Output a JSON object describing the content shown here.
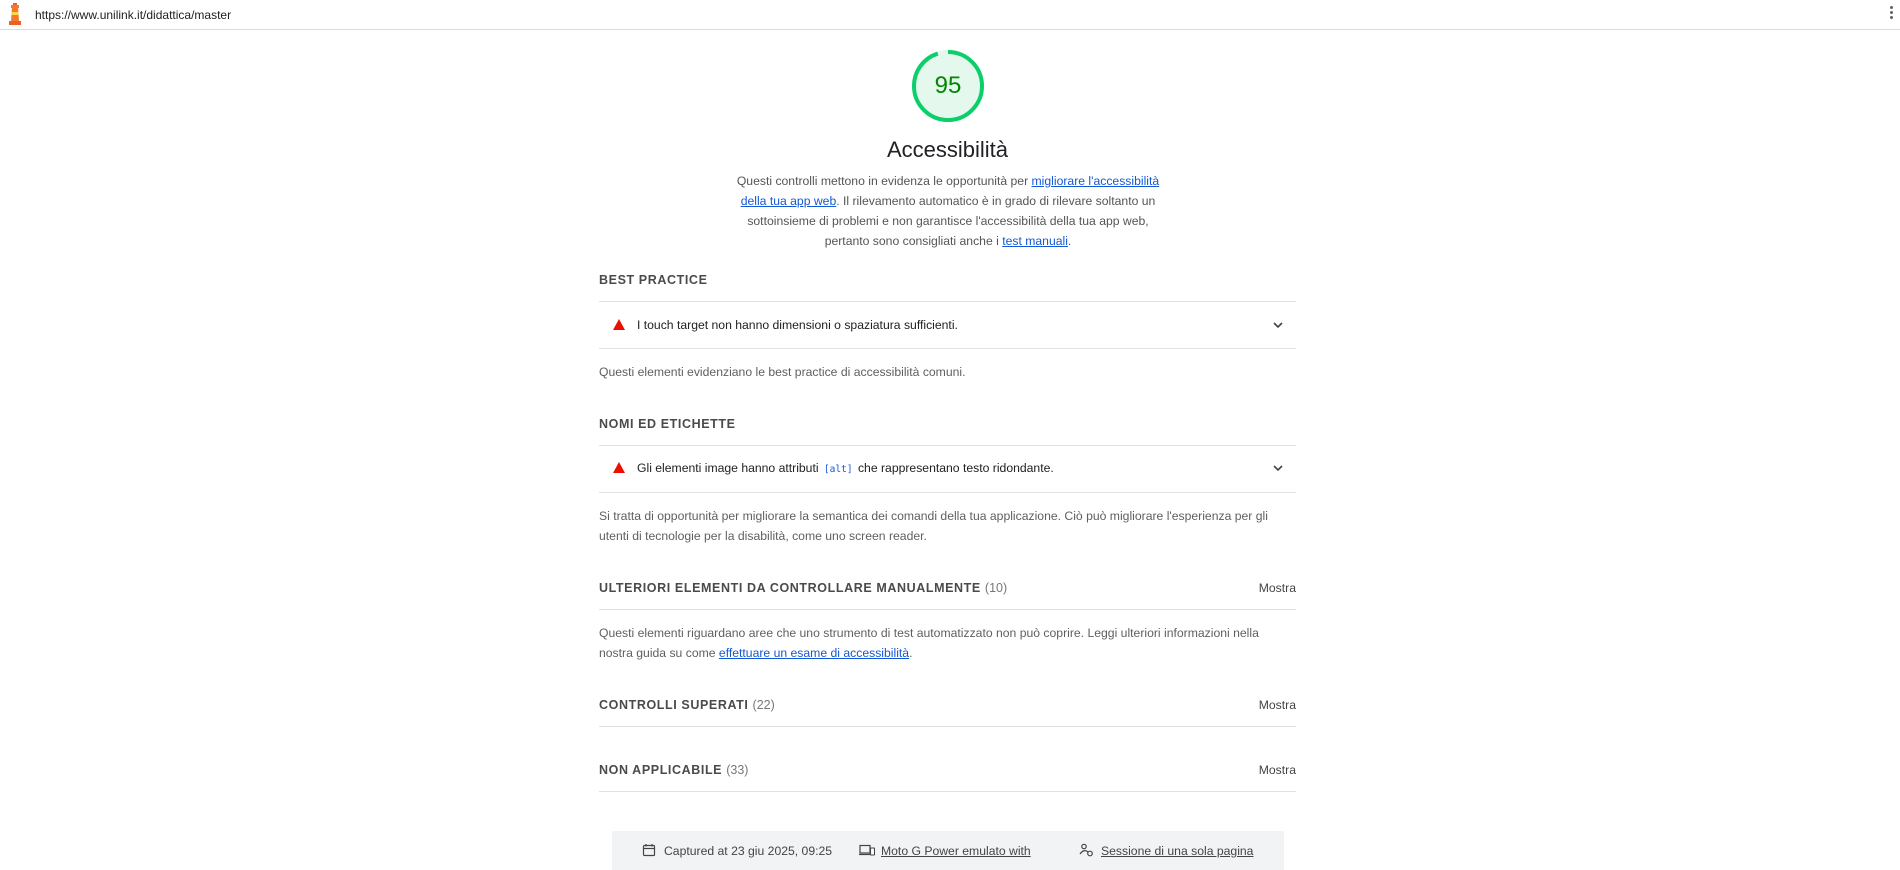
{
  "browser": {
    "url": "https://www.unilink.it/didattica/master",
    "logo_icon": "lighthouse-icon",
    "menu_icon": "more-vert-icon"
  },
  "score": {
    "value": "95",
    "color": "#0cce6b"
  },
  "category": {
    "title": "Accessibilità",
    "intro": {
      "part1": "Questi controlli mettono in evidenza le opportunità per ",
      "link1": "migliorare l'accessibilità della tua app web",
      "part2": ". Il rilevamento automatico è in grado di rilevare soltanto un sottoinsieme di problemi e non garantisce l'accessibilità della tua app web, pertanto sono consigliati anche i ",
      "link2": "test manuali",
      "part3": "."
    }
  },
  "groups": {
    "best_practice": {
      "title": "BEST PRACTICE",
      "audit": "I touch target non hanno dimensioni o spaziatura sufficienti.",
      "description": "Questi elementi evidenziano le best practice di accessibilità comuni."
    },
    "names_labels": {
      "title": "NOMI ED ETICHETTE",
      "audit_pre": "Gli elementi image hanno attributi ",
      "audit_code": "[alt]",
      "audit_post": " che rappresentano testo ridondante.",
      "description": "Si tratta di opportunità per migliorare la semantica dei comandi della tua applicazione. Ciò può migliorare l'esperienza per gli utenti di tecnologie per la disabilità, come uno screen reader."
    },
    "manual": {
      "title": "ULTERIORI ELEMENTI DA CONTROLLARE MANUALMENTE",
      "count": "(10)",
      "toggle": "Mostra",
      "desc_pre": "Questi elementi riguardano aree che uno strumento di test automatizzato non può coprire. Leggi ulteriori informazioni nella nostra guida su come ",
      "desc_link": "effettuare un esame di accessibilità",
      "desc_post": "."
    },
    "passed": {
      "title": "CONTROLLI SUPERATI",
      "count": "(22)",
      "toggle": "Mostra"
    },
    "not_applicable": {
      "title": "NON APPLICABILE",
      "count": "(33)",
      "toggle": "Mostra"
    }
  },
  "footer": {
    "captured": "Captured at 23 giu 2025, 09:25",
    "device": "Moto G Power emulato with",
    "session": "Sessione di una sola pagina"
  },
  "colors": {
    "fail": "#eb0f00",
    "pass": "#0cce6b",
    "link": "#1558d6"
  }
}
